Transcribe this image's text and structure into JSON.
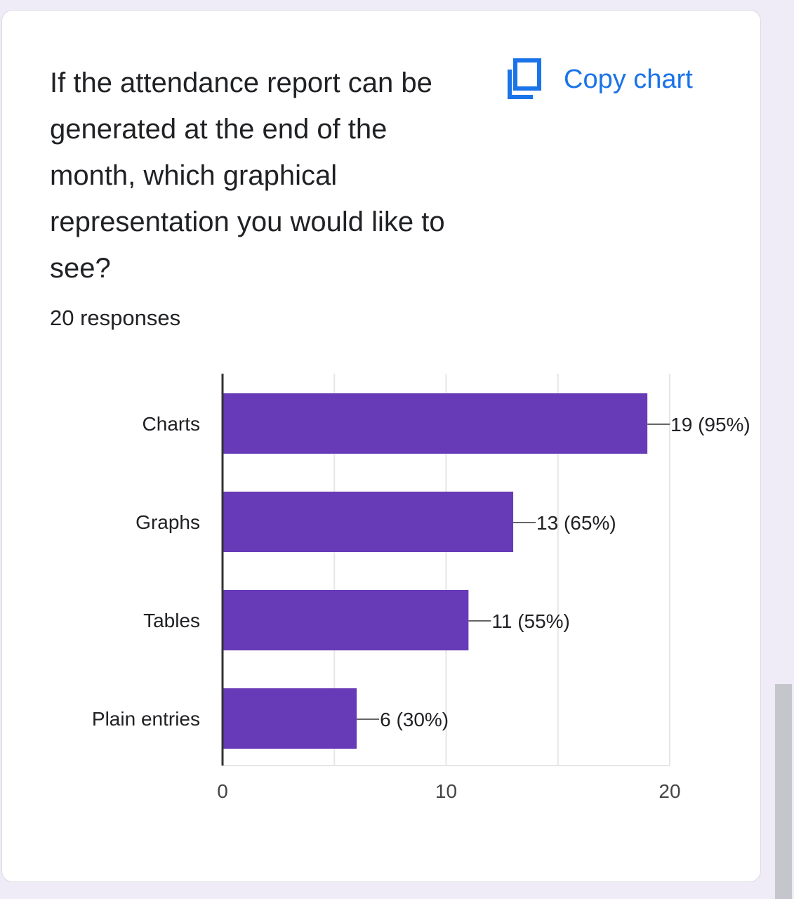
{
  "question": {
    "title": "If the attendance report can be generated at the end of the month, which graphical representation you would like to see?",
    "responses": "20 responses"
  },
  "actions": {
    "copy_label": "Copy chart",
    "copy_icon": "copy-icon"
  },
  "colors": {
    "bar": "#673ab7",
    "accent": "#1a73e8",
    "text": "#202124",
    "grid": "#e6e6e6",
    "axis": "#333333"
  },
  "chart_data": {
    "type": "bar",
    "orientation": "horizontal",
    "categories": [
      "Charts",
      "Graphs",
      "Tables",
      "Plain entries"
    ],
    "values": [
      19,
      13,
      11,
      6
    ],
    "data_labels": [
      "19 (95%)",
      "13 (65%)",
      "11 (55%)",
      "6 (30%)"
    ],
    "xlim": [
      0,
      20
    ],
    "xticks": [
      0,
      10,
      20
    ],
    "grid": true
  }
}
